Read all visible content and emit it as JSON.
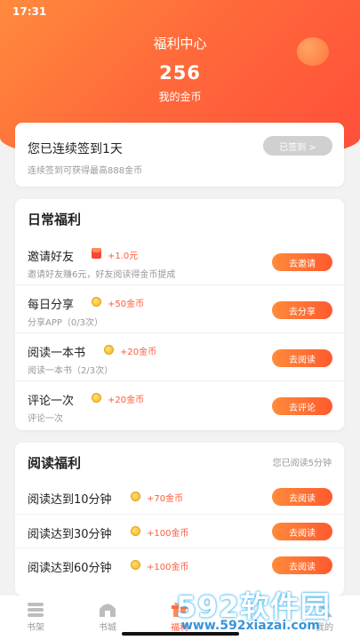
{
  "status_bar": {
    "time": "17:31"
  },
  "header": {
    "title": "福利中心",
    "coins": "256",
    "coins_label": "我的金币"
  },
  "signin": {
    "title": "您已连续签到1天",
    "subtitle": "连续签到可获得最高888金币",
    "button": "已签到 >"
  },
  "daily": {
    "title": "日常福利",
    "items": [
      {
        "name": "邀请好友",
        "reward": "+1.0元",
        "desc": "邀请好友赚6元，好友阅读得金币提成",
        "button": "去邀请",
        "icon": "red-packet-icon"
      },
      {
        "name": "每日分享",
        "reward": "+50金币",
        "desc": "分享APP（0/3次）",
        "button": "去分享",
        "icon": "coin-icon"
      },
      {
        "name": "阅读一本书",
        "reward": "+20金币",
        "desc": "阅读一本书（2/3次）",
        "button": "去阅读",
        "icon": "coin-icon"
      },
      {
        "name": "评论一次",
        "reward": "+20金币",
        "desc": "评论一次",
        "button": "去评论",
        "icon": "coin-icon"
      }
    ]
  },
  "reading": {
    "title": "阅读福利",
    "status": "您已阅读5分钟",
    "items": [
      {
        "name": "阅读达到10分钟",
        "reward": "+70金币",
        "button": "去阅读",
        "icon": "coin-icon"
      },
      {
        "name": "阅读达到30分钟",
        "reward": "+100金币",
        "button": "去阅读",
        "icon": "coin-icon"
      },
      {
        "name": "阅读达到60分钟",
        "reward": "+100金币",
        "button": "去阅读",
        "icon": "coin-icon"
      }
    ]
  },
  "tabbar": {
    "items": [
      {
        "label": "书架",
        "icon": "bookshelf-icon"
      },
      {
        "label": "书城",
        "icon": "bookstore-icon"
      },
      {
        "label": "福利",
        "icon": "gift-icon",
        "active": true
      },
      {
        "label": "我的",
        "icon": "profile-icon"
      }
    ]
  },
  "watermark": {
    "brand": "592软件园",
    "url": "www.592xiazai.com"
  },
  "colors": {
    "accent": "#ff5a3a",
    "header_start": "#ff8a3d",
    "header_end": "#ff4d3a"
  }
}
